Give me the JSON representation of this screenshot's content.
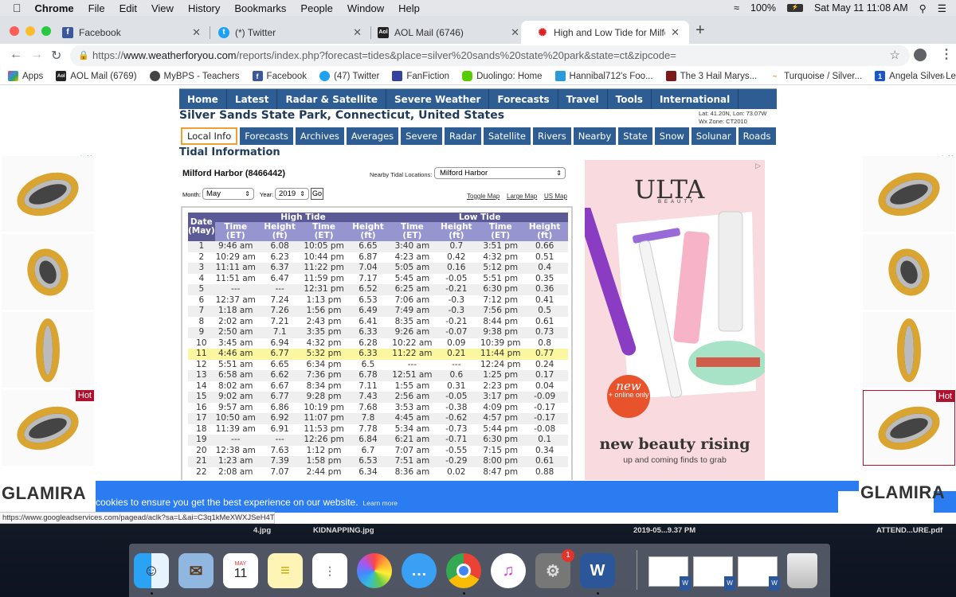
{
  "menubar": {
    "app": "Chrome",
    "items": [
      "File",
      "Edit",
      "View",
      "History",
      "Bookmarks",
      "People",
      "Window",
      "Help"
    ],
    "battery": "100%",
    "datetime": "Sat May 11  11:08 AM"
  },
  "tabs": [
    {
      "title": "Facebook",
      "icon": "facebook-icon",
      "active": false
    },
    {
      "title": "(*) Twitter",
      "icon": "twitter-icon",
      "active": false
    },
    {
      "title": "AOL Mail (6746)",
      "icon": "aol-icon",
      "active": false
    },
    {
      "title": "High and Low Tide for Milford H",
      "icon": "weatherforyou-icon",
      "active": true
    }
  ],
  "address": {
    "scheme": "https://",
    "host": "www.weatherforyou.com",
    "path": "/reports/index.php?forecast=tides&place=silver%20sands%20state%20park&state=ct&zipcode="
  },
  "bookmarks": [
    {
      "label": "Apps",
      "color": "#e8453c"
    },
    {
      "label": "AOL Mail (6769)",
      "color": "#222222"
    },
    {
      "label": "MyBPS - Teachers",
      "color": "#444444"
    },
    {
      "label": "Facebook",
      "color": "#3b5998"
    },
    {
      "label": "(47) Twitter",
      "color": "#1da1f2"
    },
    {
      "label": "FanFiction",
      "color": "#33449a"
    },
    {
      "label": "Duolingo: Home",
      "color": "#58cc02"
    },
    {
      "label": "Hannibal712's Foo...",
      "color": "#2a9bd8"
    },
    {
      "label": "The 3 Hail Marys...",
      "color": "#7a1a1a"
    },
    {
      "label": "Turquoise / Silver...",
      "color": "#f08a24"
    },
    {
      "label": "Angela Silver Leav...",
      "color": "#1a56c8"
    }
  ],
  "site": {
    "top_nav": [
      "Home",
      "Latest",
      "Radar & Satellite",
      "Severe Weather",
      "Forecasts",
      "Travel",
      "Tools",
      "International"
    ],
    "location_title": "Silver Sands State Park, Connecticut, United States",
    "latlon": "Lat: 41.20N, Lon: 73.07W",
    "wx_zone": "Wx Zone: CT2010",
    "sub_nav": [
      "Local Info",
      "Forecasts",
      "Archives",
      "Averages",
      "Severe",
      "Radar",
      "Satellite",
      "Rivers",
      "Nearby",
      "State",
      "Snow",
      "Solunar",
      "Roads"
    ],
    "active_sub_nav": "Local Info",
    "section_title": "Tidal Information",
    "station": "Milford Harbor (8466442)",
    "nearby_label": "Nearby Tidal Locations:",
    "nearby_value": "Milford Harbor",
    "month_label": "Month:",
    "month_value": "May",
    "year_label": "Year:",
    "year_value": "2019",
    "go_label": "Go",
    "map_links": [
      "Toggle Map",
      "Large Map",
      "US Map"
    ]
  },
  "tide_table": {
    "date_header": "Date (May)",
    "group_headers": [
      "High Tide",
      "Low Tide"
    ],
    "col_headers": [
      "Time (ET)",
      "Height (ft)",
      "Time (ET)",
      "Height (ft)",
      "Time (ET)",
      "Height (ft)",
      "Time (ET)",
      "Height (ft)"
    ],
    "highlight_day": 11,
    "rows": [
      [
        "1",
        "9:46 am",
        "6.08",
        "10:05 pm",
        "6.65",
        "3:40 am",
        "0.7",
        "3:51 pm",
        "0.66"
      ],
      [
        "2",
        "10:29 am",
        "6.23",
        "10:44 pm",
        "6.87",
        "4:23 am",
        "0.42",
        "4:32 pm",
        "0.51"
      ],
      [
        "3",
        "11:11 am",
        "6.37",
        "11:22 pm",
        "7.04",
        "5:05 am",
        "0.16",
        "5:12 pm",
        "0.4"
      ],
      [
        "4",
        "11:51 am",
        "6.47",
        "11:59 pm",
        "7.17",
        "5:45 am",
        "-0.05",
        "5:51 pm",
        "0.35"
      ],
      [
        "5",
        "---",
        "---",
        "12:31 pm",
        "6.52",
        "6:25 am",
        "-0.21",
        "6:30 pm",
        "0.36"
      ],
      [
        "6",
        "12:37 am",
        "7.24",
        "1:13 pm",
        "6.53",
        "7:06 am",
        "-0.3",
        "7:12 pm",
        "0.41"
      ],
      [
        "7",
        "1:18 am",
        "7.26",
        "1:56 pm",
        "6.49",
        "7:49 am",
        "-0.3",
        "7:56 pm",
        "0.5"
      ],
      [
        "8",
        "2:02 am",
        "7.21",
        "2:43 pm",
        "6.41",
        "8:35 am",
        "-0.21",
        "8:44 pm",
        "0.61"
      ],
      [
        "9",
        "2:50 am",
        "7.1",
        "3:35 pm",
        "6.33",
        "9:26 am",
        "-0.07",
        "9:38 pm",
        "0.73"
      ],
      [
        "10",
        "3:45 am",
        "6.94",
        "4:32 pm",
        "6.28",
        "10:22 am",
        "0.09",
        "10:39 pm",
        "0.8"
      ],
      [
        "11",
        "4:46 am",
        "6.77",
        "5:32 pm",
        "6.33",
        "11:22 am",
        "0.21",
        "11:44 pm",
        "0.77"
      ],
      [
        "12",
        "5:51 am",
        "6.65",
        "6:34 pm",
        "6.5",
        "---",
        "---",
        "12:24 pm",
        "0.24"
      ],
      [
        "13",
        "6:58 am",
        "6.62",
        "7:36 pm",
        "6.78",
        "12:51 am",
        "0.6",
        "1:25 pm",
        "0.17"
      ],
      [
        "14",
        "8:02 am",
        "6.67",
        "8:34 pm",
        "7.11",
        "1:55 am",
        "0.31",
        "2:23 pm",
        "0.04"
      ],
      [
        "15",
        "9:02 am",
        "6.77",
        "9:28 pm",
        "7.43",
        "2:56 am",
        "-0.05",
        "3:17 pm",
        "-0.09"
      ],
      [
        "16",
        "9:57 am",
        "6.86",
        "10:19 pm",
        "7.68",
        "3:53 am",
        "-0.38",
        "4:09 pm",
        "-0.17"
      ],
      [
        "17",
        "10:50 am",
        "6.92",
        "11:07 pm",
        "7.8",
        "4:45 am",
        "-0.62",
        "4:57 pm",
        "-0.17"
      ],
      [
        "18",
        "11:39 am",
        "6.91",
        "11:53 pm",
        "7.78",
        "5:34 am",
        "-0.73",
        "5:44 pm",
        "-0.08"
      ],
      [
        "19",
        "---",
        "---",
        "12:26 pm",
        "6.84",
        "6:21 am",
        "-0.71",
        "6:30 pm",
        "0.1"
      ],
      [
        "20",
        "12:38 am",
        "7.63",
        "1:12 pm",
        "6.7",
        "7:07 am",
        "-0.55",
        "7:15 pm",
        "0.34"
      ],
      [
        "21",
        "1:23 am",
        "7.39",
        "1:58 pm",
        "6.53",
        "7:51 am",
        "-0.29",
        "8:00 pm",
        "0.61"
      ],
      [
        "22",
        "2:08 am",
        "7.07",
        "2:44 pm",
        "6.34",
        "8:36 am",
        "0.02",
        "8:47 pm",
        "0.88"
      ]
    ]
  },
  "ads": {
    "side_brand": "GLAMIRA",
    "hot_label": "Hot",
    "ulta": {
      "logo": "ULTA",
      "logo_sub": "BEAUTY",
      "badge_new": "new",
      "badge_sub": "+ online only",
      "headline": "new beauty rising",
      "subline": "up and coming finds to grab"
    }
  },
  "cookie_banner": {
    "text": "cookies to ensure you get the best experience on our website.",
    "learn_more": "Learn more"
  },
  "status_url": "https://www.googleadservices.com/pagead/aclk?sa=L&ai=C3q1kMeXWXJSeH4T...",
  "desktop_files": [
    "4.jpg",
    "KIDNAPPING.jpg",
    "2019-05...9.37 PM",
    "ATTEND...URE.pdf"
  ],
  "dock": {
    "calendar_month": "MAY",
    "calendar_day": "11",
    "settings_badge": "1"
  }
}
